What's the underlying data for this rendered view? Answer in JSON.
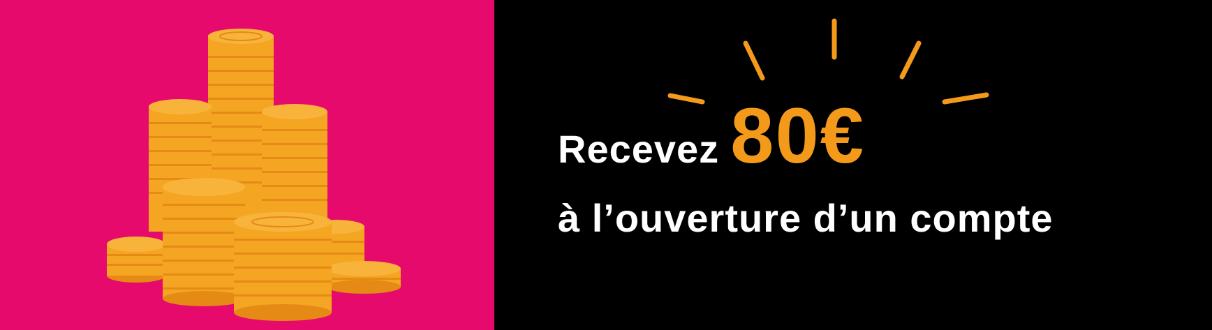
{
  "offer": {
    "intro": "Recevez",
    "amount": "80€",
    "subtitle": "à l’ouverture d’un compte"
  },
  "colors": {
    "left_background": "#e60a6c",
    "right_background": "#000000",
    "accent": "#f39a1b",
    "text": "#ffffff",
    "coin_face": "#f4a623",
    "coin_edge": "#e58a14"
  },
  "illustration": {
    "icon": "coin-stacks-icon",
    "sparkle": "sparkle-rays-icon"
  }
}
